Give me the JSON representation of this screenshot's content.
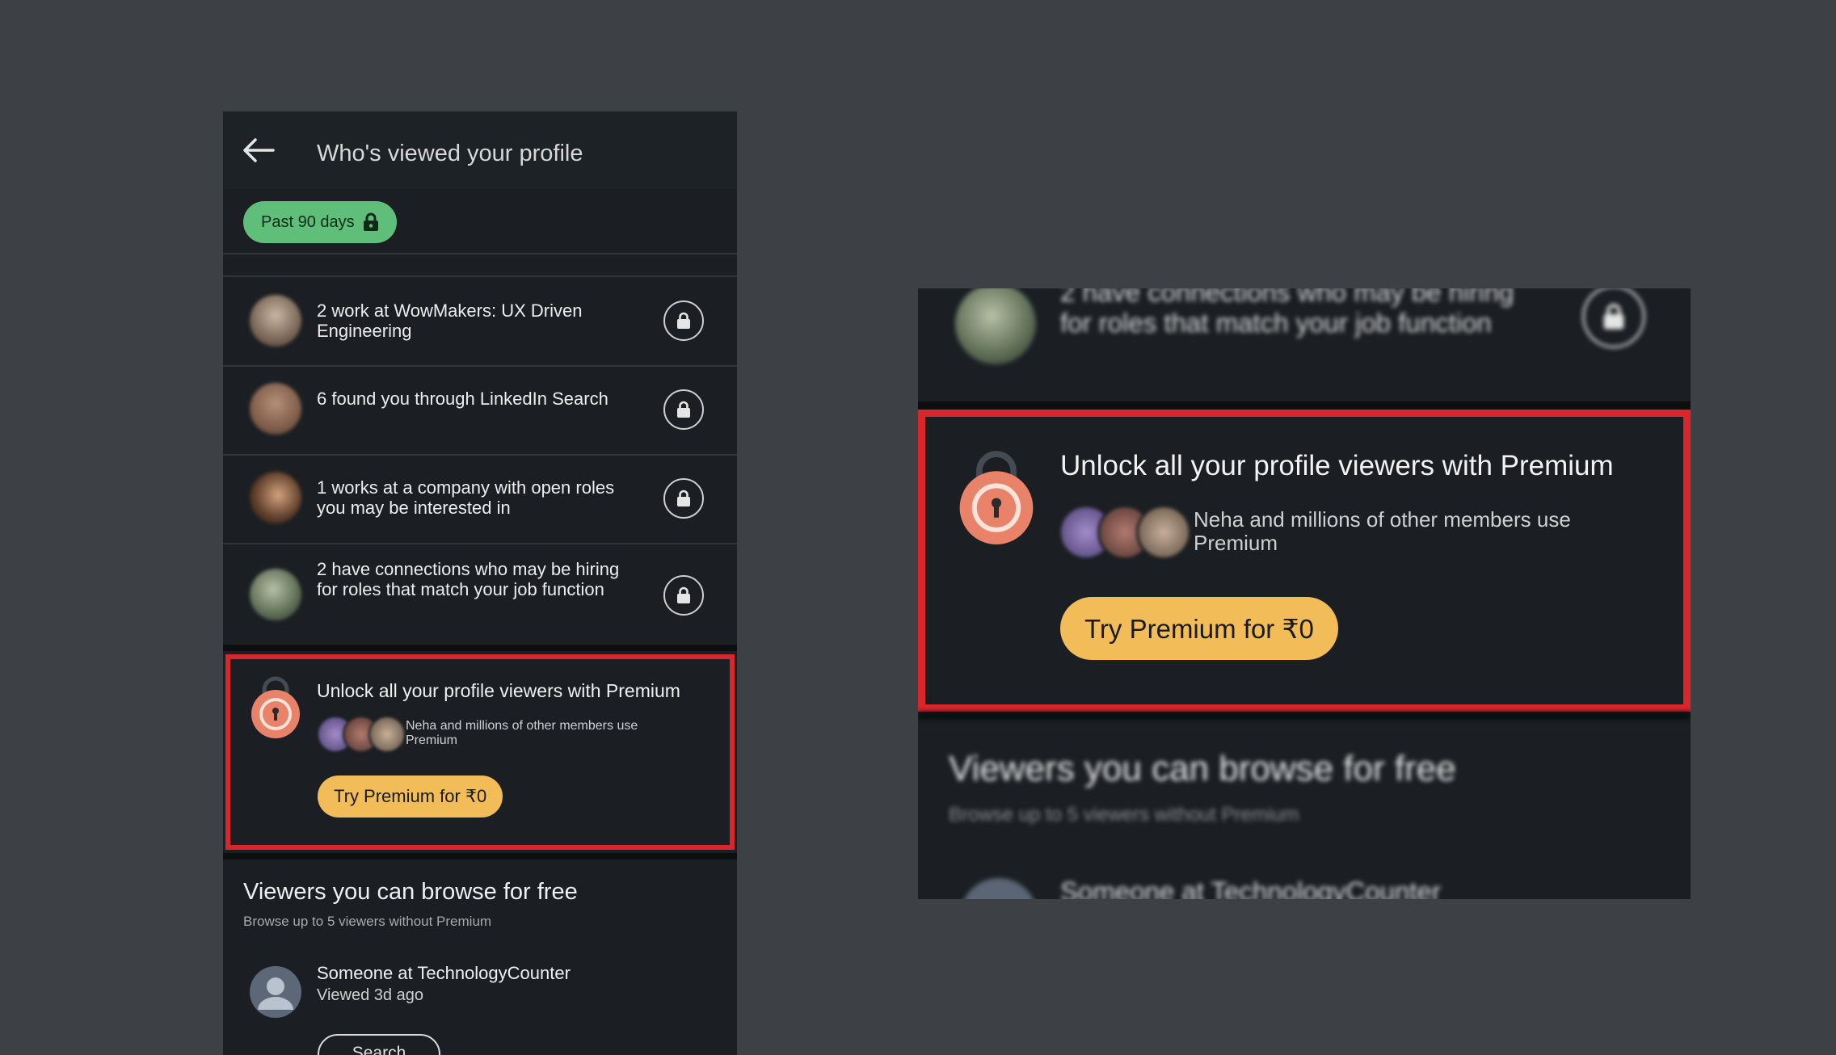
{
  "header": {
    "title": "Who's viewed your profile"
  },
  "filter": {
    "label": "Past 90 days"
  },
  "insights": [
    {
      "text": "2 work at WowMakers: UX Driven Engineering"
    },
    {
      "text": "6 found you through LinkedIn Search"
    },
    {
      "text": "1 works at a company with open roles you may be interested in"
    },
    {
      "text": "2 have connections who may be hiring for roles that match your job function"
    }
  ],
  "premium": {
    "title": "Unlock all your profile viewers with Premium",
    "subtitle": "Neha and millions of other members use Premium",
    "cta": "Try Premium for ₹0"
  },
  "free": {
    "title": "Viewers you can browse for free",
    "subtitle": "Browse up to 5 viewers without Premium",
    "viewer": {
      "name": "Someone at TechnologyCounter",
      "time": "Viewed 3d ago",
      "action": "Search"
    }
  },
  "colors": {
    "background": "#3d4045",
    "panel": "#1b1f23",
    "chip": "#5fbf7a",
    "cta": "#f2bd58",
    "highlight": "#d8262b",
    "padlock": "#e8836a"
  }
}
